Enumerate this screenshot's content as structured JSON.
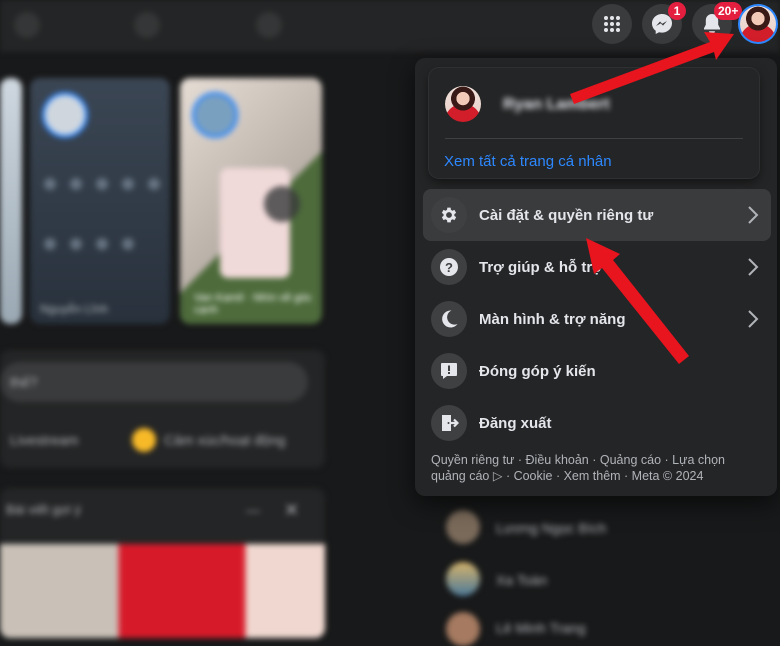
{
  "topbar": {
    "icons": [
      "menu-grid-icon",
      "messenger-icon",
      "bell-icon",
      "avatar"
    ],
    "messenger_badge": "1",
    "notifications_badge": "20+"
  },
  "menu": {
    "profile_name": "Ryan Lambert",
    "see_all_profiles": "Xem tất cả trang cá nhân",
    "items": [
      {
        "label": "Cài đặt & quyền riêng tư",
        "icon": "gear-icon",
        "has_chevron": true
      },
      {
        "label": "Trợ giúp & hỗ trợ",
        "icon": "question-icon",
        "has_chevron": true
      },
      {
        "label": "Màn hình & trợ năng",
        "icon": "moon-icon",
        "has_chevron": true
      },
      {
        "label": "Đóng góp ý kiến",
        "icon": "feedback-icon",
        "has_chevron": false
      },
      {
        "label": "Đăng xuất",
        "icon": "logout-icon",
        "has_chevron": false
      }
    ],
    "footer_line1": "Quyền riêng tư · Điều khoản · Quảng cáo · Lựa chọn",
    "footer_line2": "quảng cáo ▷ · Cookie · Xem thêm · Meta © 2024"
  },
  "background": {
    "story_weather_label": "Nguyễn Lĩnh",
    "story_second_label": "Van Kamil · Nhìn về góc cạnh",
    "post_prompt": "thế?",
    "video_label": "Livestream",
    "feeling_label": "Cảm xúc/hoạt động",
    "suggested_header": "Bài viết gợi ý",
    "contacts": [
      "Lương Ngọc Bích",
      "Xa Toàn",
      "Lê Minh Trang"
    ]
  },
  "colors": {
    "accent_link": "#2d88ff",
    "badge": "#e41e3f",
    "annotation_arrow": "#e8141e"
  }
}
